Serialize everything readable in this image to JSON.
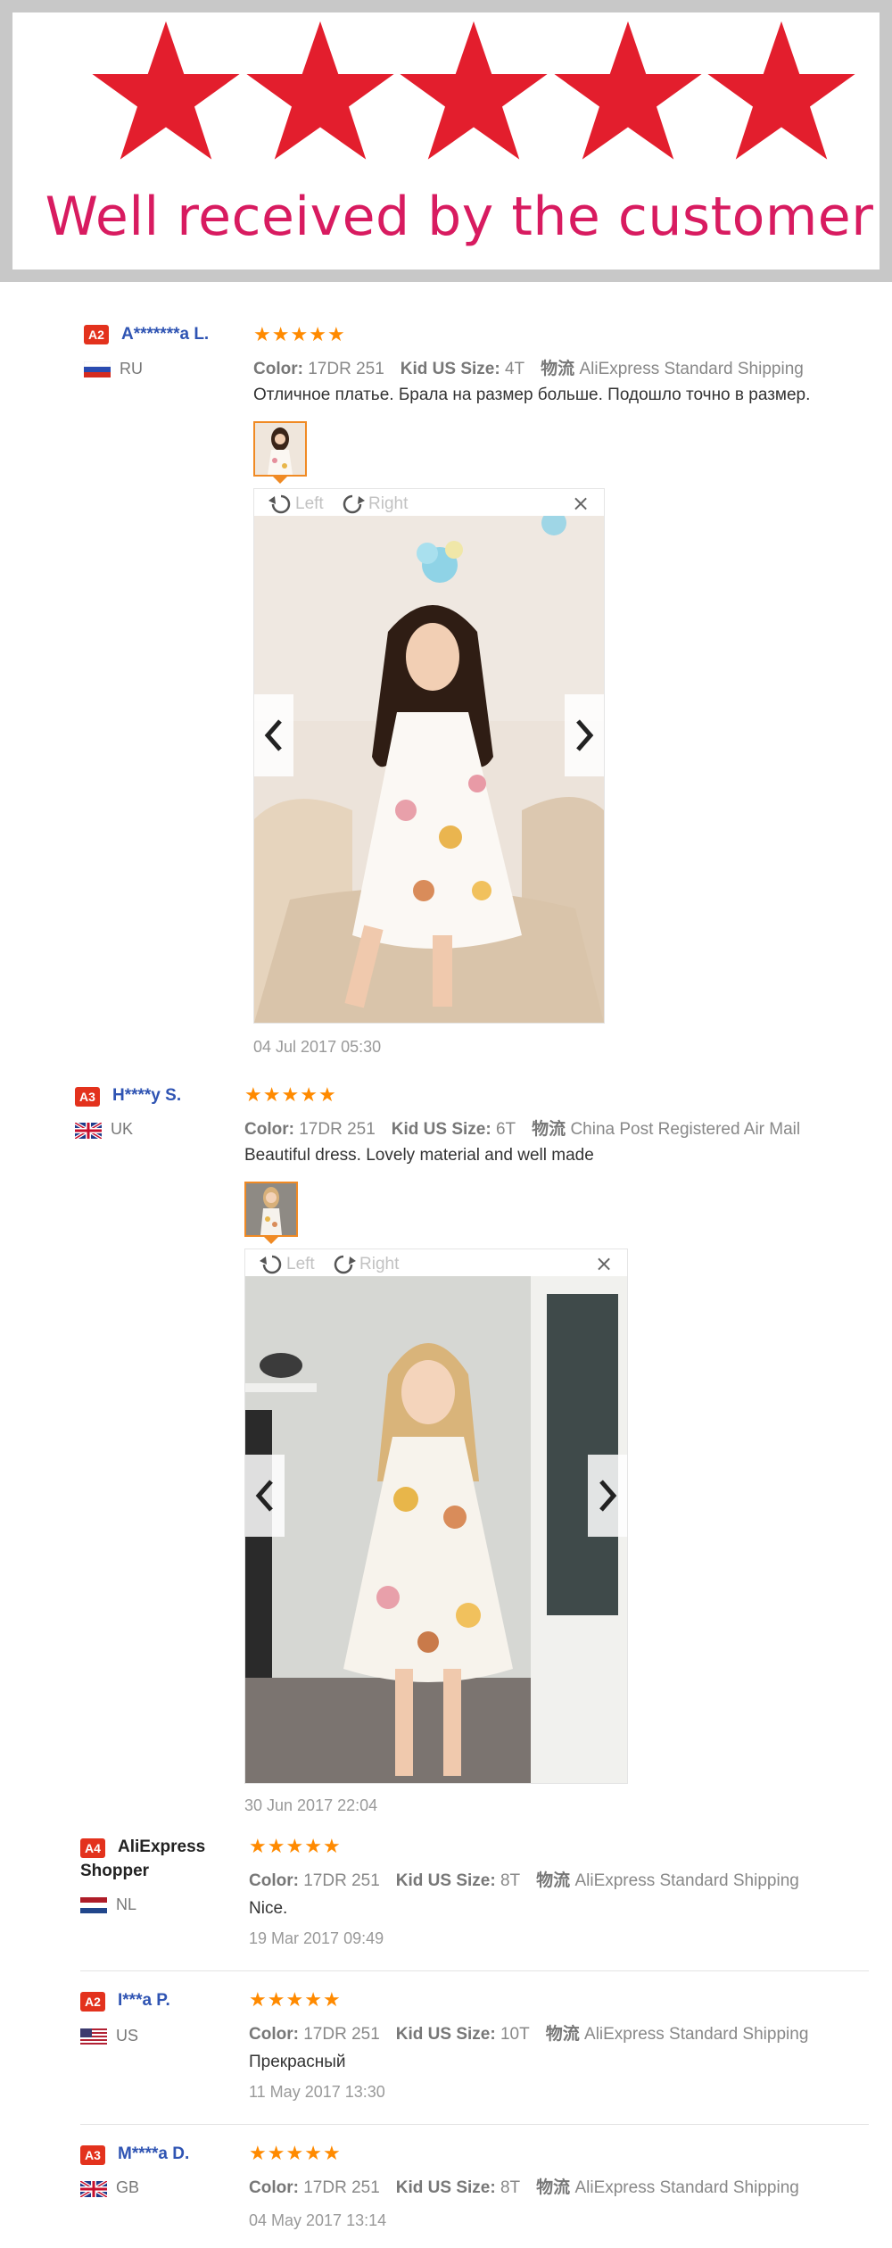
{
  "banner": {
    "star_count": 5,
    "star_color": "#e31e2d",
    "title": "Well received by the customer",
    "title_color": "#d81b60"
  },
  "labels": {
    "color": "Color:",
    "kid_size": "Kid US Size:",
    "shipping_prefix": "物流",
    "rotate_left": "Left",
    "rotate_right": "Right",
    "close": "×"
  },
  "reviews": [
    {
      "badge": "A2",
      "name": "A*******a L.",
      "country": "RU",
      "stars": 5,
      "color": "17DR 251",
      "size": "4T",
      "shipping": "AliExpress Standard Shipping",
      "text": "Отличное платье. Брала на размер больше. Подошло точно в размер.",
      "date": "04 Jul 2017 05:30"
    },
    {
      "badge": "A3",
      "name": "H****y S.",
      "country": "UK",
      "stars": 5,
      "color": "17DR 251",
      "size": "6T",
      "shipping": "China Post Registered Air Mail",
      "text": "Beautiful dress. Lovely material and well made",
      "date": "30 Jun 2017 22:04"
    },
    {
      "badge": "A4",
      "name_line1": "AliExpress",
      "name_line2": "Shopper",
      "country": "NL",
      "stars": 5,
      "color": "17DR 251",
      "size": "8T",
      "shipping": "AliExpress Standard Shipping",
      "text": "Nice.",
      "date": "19 Mar 2017 09:49"
    },
    {
      "badge": "A2",
      "name": "I***a P.",
      "country": "US",
      "stars": 5,
      "color": "17DR 251",
      "size": "10T",
      "shipping": "AliExpress Standard Shipping",
      "text": "Прекрасный",
      "date": "11 May 2017 13:30"
    },
    {
      "badge": "A3",
      "name": "M****a D.",
      "country": "GB",
      "stars": 5,
      "color": "17DR 251",
      "size": "8T",
      "shipping": "AliExpress Standard Shipping",
      "date": "04 May 2017 13:14"
    }
  ]
}
